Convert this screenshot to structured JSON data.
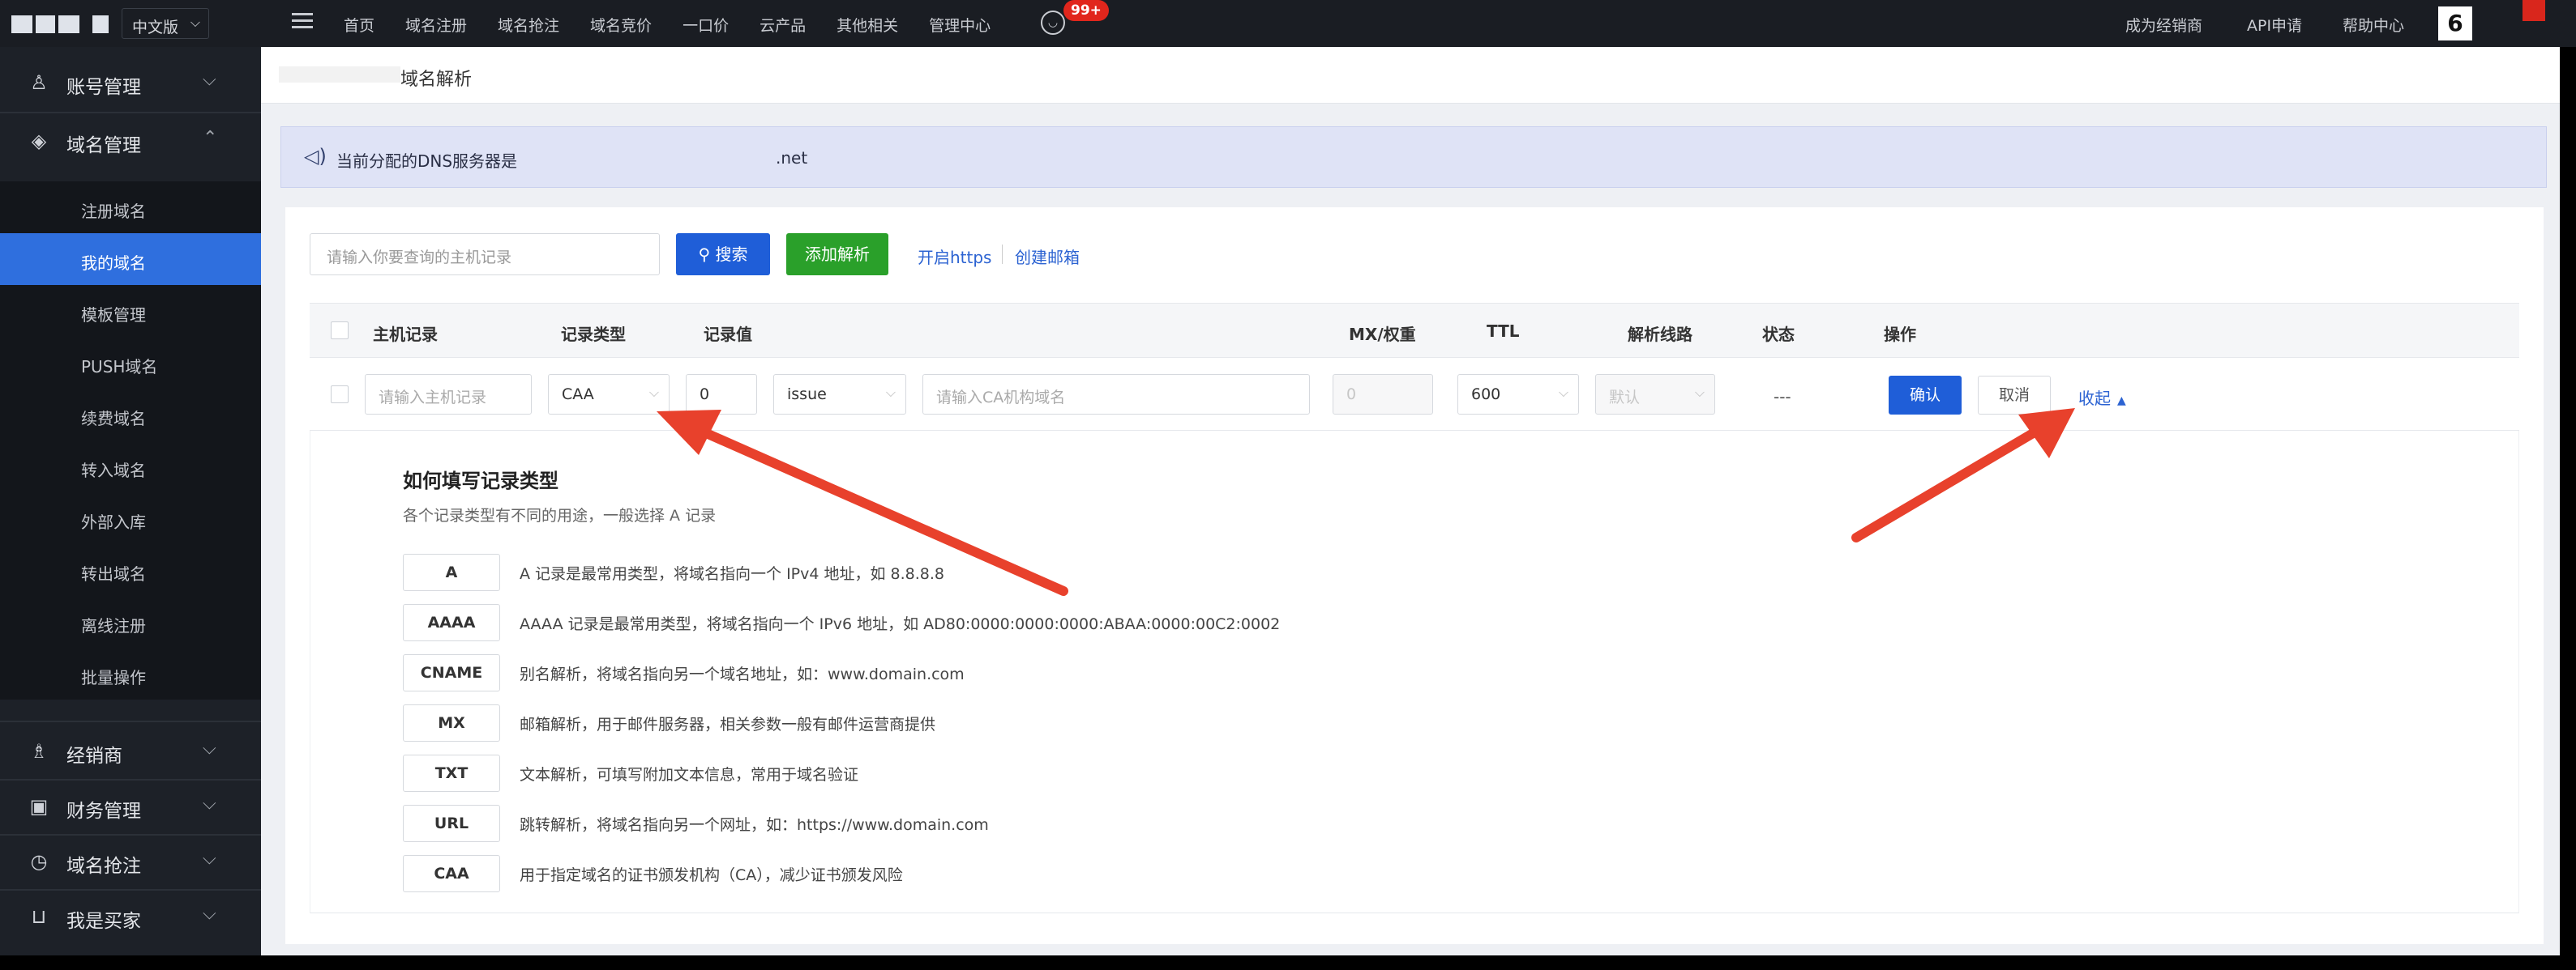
{
  "topbar": {
    "lang": "中文版",
    "nav": [
      "首页",
      "域名注册",
      "域名抢注",
      "域名竞价",
      "一口价",
      "云产品",
      "其他相关",
      "管理中心"
    ],
    "msg_badge": "99+",
    "right_links": [
      "成为经销商",
      "API申请",
      "帮助中心"
    ],
    "user_initial": "6"
  },
  "sidebar": {
    "sections": {
      "account": "账号管理",
      "domain": "域名管理",
      "dealer": "经销商",
      "finance": "财务管理",
      "snap": "域名抢注",
      "buyer": "我是买家"
    },
    "domain_items": [
      "注册域名",
      "我的域名",
      "模板管理",
      "PUSH域名",
      "续费域名",
      "转入域名",
      "外部入库",
      "转出域名",
      "离线注册",
      "批量操作"
    ]
  },
  "page": {
    "title": "域名解析",
    "notice": "当前分配的DNS服务器是",
    "dns_suffix": ".net"
  },
  "toolbar": {
    "search_placeholder": "请输入你要查询的主机记录",
    "search_label": "搜索",
    "add_label": "添加解析",
    "https_label": "开启https",
    "mail_label": "创建邮箱"
  },
  "table": {
    "headers": [
      "主机记录",
      "记录类型",
      "记录值",
      "MX/权重",
      "TTL",
      "解析线路",
      "状态",
      "操作"
    ]
  },
  "edit_row": {
    "host_placeholder": "请输入主机记录",
    "type": "CAA",
    "flag": "0",
    "tag": "issue",
    "value_placeholder": "请输入CA机构域名",
    "mx": "0",
    "ttl": "600",
    "line": "默认",
    "status": "---",
    "confirm": "确认",
    "cancel": "取消",
    "collapse": "收起"
  },
  "guide": {
    "title": "如何填写记录类型",
    "subtitle": "各个记录类型有不同的用途，一般选择 A 记录",
    "types": [
      {
        "name": "A",
        "desc": "A 记录是最常用类型，将域名指向一个 IPv4 地址，如 8.8.8.8"
      },
      {
        "name": "AAAA",
        "desc": "AAAA 记录是最常用类型，将域名指向一个 IPv6 地址，如 AD80:0000:0000:0000:ABAA:0000:00C2:0002"
      },
      {
        "name": "CNAME",
        "desc": "别名解析，将域名指向另一个域名地址，如：www.domain.com"
      },
      {
        "name": "MX",
        "desc": "邮箱解析，用于邮件服务器，相关参数一般有邮件运营商提供"
      },
      {
        "name": "TXT",
        "desc": "文本解析，可填写附加文本信息，常用于域名验证"
      },
      {
        "name": "URL",
        "desc": "跳转解析，将域名指向另一个网址，如：https://www.domain.com"
      },
      {
        "name": "CAA",
        "desc": "用于指定域名的证书颁发机构（CA），减少证书颁发风险"
      }
    ]
  },
  "colors": {
    "primary": "#1f5ed8",
    "success": "#2aa02a",
    "sidebar_active": "#2f6fde",
    "arrow": "#e8412c"
  }
}
